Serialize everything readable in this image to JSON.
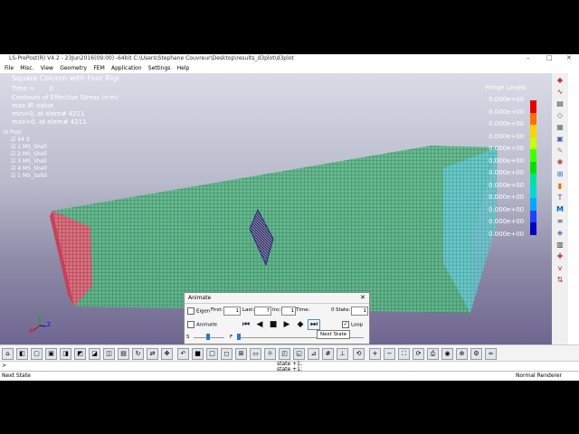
{
  "window": {
    "title": "LS-PrePost(R) V4.2 - 23Jun2016(09:00) -64bit C:\\Users\\Stephane Couvreur\\Desktop\\results_d3plot\\d3plot",
    "minimize": "–",
    "maximize": "□",
    "close": "✕"
  },
  "menu": [
    "File",
    "Misc.",
    "View",
    "Geometry",
    "FEM",
    "Application",
    "Settings",
    "Help"
  ],
  "overlay": {
    "heading": "Square Column with Four Rigi",
    "time_label": "Time =",
    "time_value": "0",
    "contours": "Contours of Effective Stress (v-m)",
    "value_line": "max IP. value",
    "min_line": "min=0, at elem# 4211",
    "max_line": "max=0, at elem# 4211",
    "fringe_title": "Fringe Levels"
  },
  "fringe": {
    "values": [
      "0.000e+00",
      "0.000e+00",
      "0.000e+00",
      "0.000e+00",
      "0.000e+00",
      "0.000e+00",
      "0.000e+00",
      "0.000e+00",
      "0.000e+00",
      "0.000e+00",
      "0.000e+00",
      "0.000e+00"
    ],
    "colors": [
      "#e60000",
      "#ff7000",
      "#ffd200",
      "#c8ff00",
      "#42ff00",
      "#00e000",
      "#00e0a0",
      "#00d8d8",
      "#00a8ff",
      "#2040ff",
      "#0000c0"
    ]
  },
  "parts": {
    "root": "Post",
    "items": [
      "44 S",
      "1 MS_Shell",
      "2 MS_Shell",
      "3 MS_Shell",
      "4 MS_Shell",
      "1 MS_Solid"
    ]
  },
  "axes": {
    "x": "X",
    "y": "Y",
    "z": "Z"
  },
  "animate": {
    "title": "Animate",
    "eigen_label": "Eigen",
    "first_label": "First:",
    "first_value": "1",
    "last_label": "Last:",
    "last_value": "7",
    "inc_label": "Inc:",
    "inc_value": "1",
    "time_label": "Time:",
    "time_value": "0",
    "state_label": "State:",
    "state_value": "1",
    "animate_label": "Animate",
    "loop_label": "Loop",
    "loop_checked": true,
    "slow_label": "S",
    "fast_label": "F",
    "close": "✕"
  },
  "tooltip": "Next State",
  "console": {
    "line1": "state +1;",
    "line2": "state +1;"
  },
  "status": {
    "left": "Next State",
    "right": "Normal Renderer"
  },
  "colors": {
    "mesh_green": "#2d9e5c",
    "mesh_red": "#d83a4e",
    "mesh_cyan": "#3ab8c8",
    "wall": "#2a2a8a"
  }
}
